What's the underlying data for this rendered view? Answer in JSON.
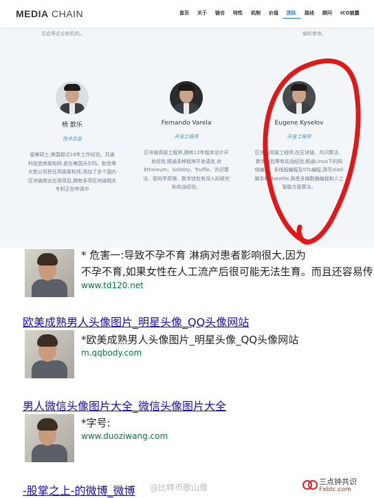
{
  "site": {
    "logo_bold": "MEDIA",
    "logo_light": "CHAIN",
    "nav": [
      "首页",
      "关于",
      "链合",
      "特性",
      "机制",
      "价值",
      "团队",
      "路线",
      "顾问",
      "ICO披露"
    ],
    "active_nav": "团队",
    "top_fragment_left": "总会等企业和机构。",
    "top_fragment_right": "编和审查。",
    "members": [
      {
        "name": "杨 歆乐",
        "role": "技术总监",
        "desc": "留美硕士,美国超过18年工作经验。并通科技首席架构师;曾在美国沃尔玛、耐克等大型公司担任高级架构师;添加了多个国内区块链商业应用项目,拥有多项区块链相关专利正在申请中"
      },
      {
        "name": "Fernando Varela",
        "role": "开发工程师",
        "desc": "区块链高级工程师,拥有12年程序设计开发经验,精通多种程序开发语言,对Ethereum、Solidity、Truffle、共识算法、密码学原理、数字钱包有深入的研究和实战经验。"
      },
      {
        "name": "Eugene Kyselov",
        "role": "开发工程师",
        "desc": "区块链高级工程师,在区块链、共识算法、数字钱包等有实战经验,精通Linux下的网络编程、多线程编程及STL编程,熟写shell脚本和Makefile,熟悉多媒数据编程和人工智能方面算法。"
      }
    ]
  },
  "results": [
    {
      "title": "",
      "snippet_line1": "* 危害一:导致不孕不育 淋病对患者影响很大,因为",
      "snippet_line2": "不孕不育,如果女性在人工流产后很可能无法生育。而且还容易传",
      "url": "www.td120.net"
    },
    {
      "title": "欧美成熟男人头像图片_明星头像_QQ头像网站",
      "snippet_line1": "*欧美成熟男人头像图片_明星头像_QQ头像网站",
      "snippet_line2": "",
      "url": "m.qqbody.com"
    },
    {
      "title": "男人微信头像图片大全_微信头像图片大全",
      "snippet_line1": "*字号:",
      "snippet_line2": "",
      "url": "www.duoziwang.com"
    },
    {
      "title": "-股掌之上-的微博_微博",
      "snippet_line1": "",
      "snippet_line2": "",
      "url": ""
    }
  ],
  "watermark": {
    "weibo": "@比特币歌山僧",
    "brand": "三点钟共识",
    "brand_sub": "Fxbtc.com"
  },
  "colors": {
    "link": "#1a0dab",
    "url": "#007a3d",
    "accent": "#1a73c8",
    "annotation": "#e01818"
  }
}
